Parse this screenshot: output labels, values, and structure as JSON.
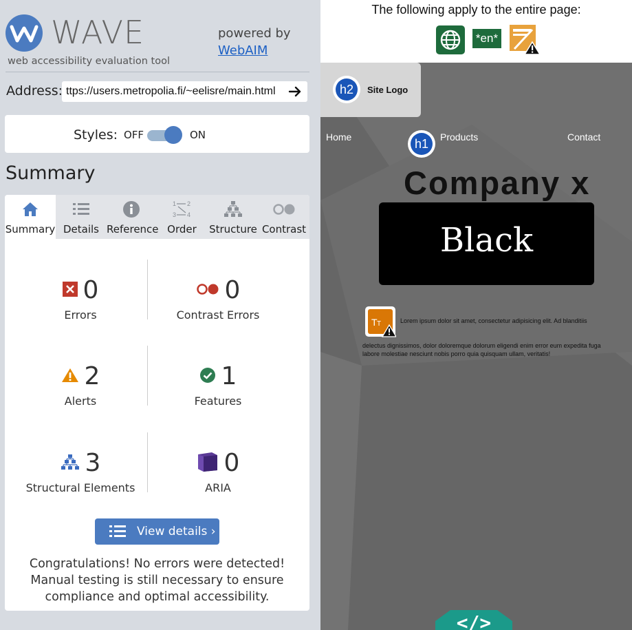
{
  "panel": {
    "brand": "WAVE",
    "tagline": "web accessibility evaluation tool",
    "powered_by": "powered by",
    "powered_link": "WebAIM",
    "address_label": "Address:",
    "address_value": "ttps://users.metropolia.fi/~eelisre/main.html",
    "styles_label": "Styles:",
    "styles_off": "OFF",
    "styles_on": "ON",
    "styles_state": "on",
    "heading": "Summary",
    "tabs": [
      {
        "label": "Summary",
        "icon": "home-icon",
        "active": true
      },
      {
        "label": "Details",
        "icon": "list-icon",
        "active": false
      },
      {
        "label": "Reference",
        "icon": "info-icon",
        "active": false
      },
      {
        "label": "Order",
        "icon": "order-icon",
        "active": false
      },
      {
        "label": "Structure",
        "icon": "structure-icon",
        "active": false
      },
      {
        "label": "Contrast",
        "icon": "contrast-icon",
        "active": false
      }
    ],
    "counts": {
      "errors": {
        "value": "0",
        "label": "Errors"
      },
      "contrast_errors": {
        "value": "0",
        "label": "Contrast Errors"
      },
      "alerts": {
        "value": "2",
        "label": "Alerts"
      },
      "features": {
        "value": "1",
        "label": "Features"
      },
      "structural": {
        "value": "3",
        "label": "Structural Elements"
      },
      "aria": {
        "value": "0",
        "label": "ARIA"
      }
    },
    "view_details": "View details ›",
    "congrats": "Congratulations! No errors were detected! Manual testing is still necessary to ensure compliance and optimal accessibility."
  },
  "page": {
    "applies": "The following apply to the entire page:",
    "lang_badge": "*en*",
    "h2_badge": "h2",
    "h1_badge": "h1",
    "site_logo": "Site Logo",
    "nav": {
      "home": "Home",
      "products": "Products",
      "contact": "Contact"
    },
    "company": "Company x",
    "black": "Black",
    "lorem_line1": "Lorem ipsum dolor sit amet, consectetur adipisicing elit. Ad blanditiis",
    "lorem_line2": "delectus dignissimos, dolor doloremque dolorum eligendi enim error eum expedita fuga labore molestiae nesciunt nobis porro quia quisquam ullam, veritatis!",
    "code_toggle": "</>"
  },
  "colors": {
    "accent": "#4b7bc0",
    "error": "#c0392b",
    "alert": "#e68a00",
    "feature": "#2e7d52",
    "aria": "#4b2a82",
    "code_tab": "#1b9a8a"
  }
}
